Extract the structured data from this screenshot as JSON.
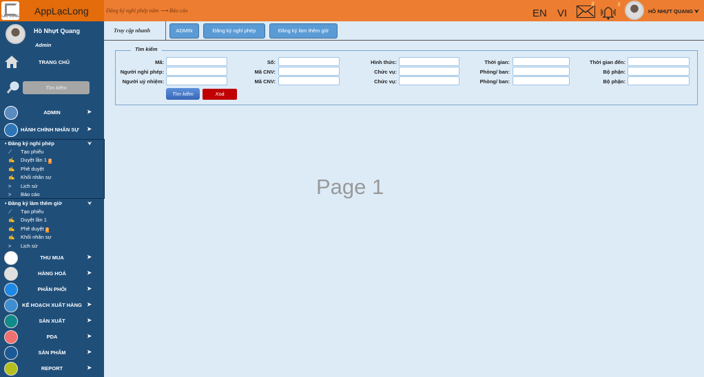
{
  "header": {
    "logo_text": "LẠC LONG",
    "app_title": "AppLạcLong",
    "breadcrumb": "Đăng ký nghỉ phép năm ⟶ Báo cáo",
    "lang_en": "EN",
    "lang_vi": "VI",
    "mail_count": "2",
    "bell_count": "2",
    "user_name": "HỒ NHỰT QUANG",
    "user_chevron": "⮟"
  },
  "sidebar": {
    "user_name": "Hồ Nhựt Quang",
    "role": "Admin",
    "home": "TRANG CHỦ",
    "search_placeholder": "Tìm kiếm",
    "top_items": [
      {
        "label": "ADMIN",
        "chev": "➤"
      },
      {
        "label": "HÀNH CHÍNH NHÂN SỰ",
        "chev": "➤"
      }
    ],
    "leave": {
      "title": "• Đăng ký nghỉ phép",
      "chev": "⮟",
      "items": [
        {
          "icon": "⟋",
          "label": "Tạo phiếu"
        },
        {
          "icon": "✍",
          "label": "Duyệt lần 1",
          "badge": "2"
        },
        {
          "icon": "✍",
          "label": "Phê duyệt"
        },
        {
          "icon": "✍",
          "label": "Khối nhân sự"
        },
        {
          "icon": ">",
          "label": "Lịch sử"
        },
        {
          "icon": ">",
          "label": "Báo cáo"
        }
      ]
    },
    "overtime": {
      "title": "• Đăng ký làm thêm giờ",
      "chev": "⮟",
      "items": [
        {
          "icon": "⟋",
          "label": "Tạo phiếu"
        },
        {
          "icon": "✍",
          "label": "Duyệt lần 1"
        },
        {
          "icon": "✍",
          "label": "Phê duyệt",
          "badge": "2"
        },
        {
          "icon": "✍",
          "label": "Khối nhân sự"
        },
        {
          "icon": ">",
          "label": "Lịch sử"
        }
      ]
    },
    "modules": [
      {
        "label": "THU MUA",
        "chev": "➤",
        "color": "#ffffff"
      },
      {
        "label": "HÀNG HOÁ",
        "chev": "➤",
        "color": "#e0e0e0"
      },
      {
        "label": "PHÂN PHỐI",
        "chev": "➤",
        "color": "#1E88E5"
      },
      {
        "label": "KẾ HOẠCH XUẤT HÀNG",
        "chev": "➤",
        "color": "#3f8fd0"
      },
      {
        "label": "SẢN XUẤT",
        "chev": "➤",
        "color": "#138a8a"
      },
      {
        "label": "PDA",
        "chev": "➤",
        "color": "#f07070"
      },
      {
        "label": "SẢN PHẨM",
        "chev": "➤",
        "color": "#1b5a96"
      },
      {
        "label": "REPORT",
        "chev": "➤",
        "color": "#b5c020"
      }
    ]
  },
  "quick": {
    "label": "Truy cập nhanh",
    "buttons": [
      "ADMIN",
      "Đăng ký nghỉ phép",
      "Đăng ký làm thêm giờ"
    ]
  },
  "search": {
    "legend": "Tìm kiếm",
    "fields": [
      [
        "Mã:",
        "Số:",
        "Hình thức:",
        "Thời gian:",
        "Thời gian đến:"
      ],
      [
        "Người nghỉ phép:",
        "Mã CNV:",
        "Chức vụ:",
        "Phòng/ ban:",
        "Bộ phận:"
      ],
      [
        "Người uỷ nhiệm:",
        "Mã CNV:",
        "Chức vụ:",
        "Phòng/ ban:",
        "Bộ phận:"
      ]
    ],
    "search_button": "Tìm kiếm",
    "clear_button": "Xoá"
  },
  "main": {
    "page_label": "Page 1"
  }
}
